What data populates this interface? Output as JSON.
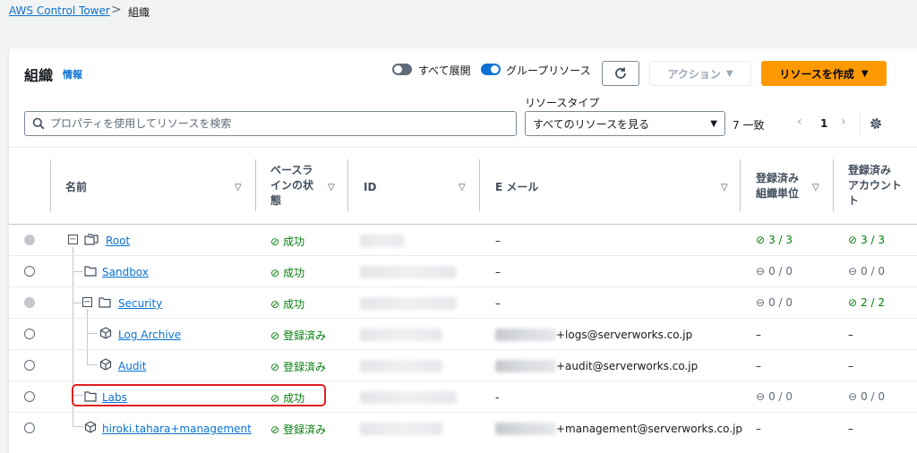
{
  "breadcrumb": {
    "root": "AWS Control Tower",
    "separator": ">",
    "current": "組織"
  },
  "panel": {
    "title": "組織",
    "info": "情報",
    "expand_all_label": "すべて展開",
    "group_resources_label": "グループリソース",
    "action_label": "アクション",
    "create_label": "リソースを作成",
    "search_placeholder": "プロパティを使用してリソースを検索",
    "resource_type_label": "リソースタイプ",
    "resource_type_value": "すべてのリソースを見る",
    "match_count": "7 一致",
    "page": "1"
  },
  "columns": {
    "name": "名前",
    "baseline_1": "ベースラ",
    "baseline_2": "インの状",
    "baseline_3": "態",
    "id": "ID",
    "email": "E メール",
    "ou_1": "登録済み",
    "ou_2": "組織単位",
    "acct_1": "登録済み",
    "acct_2": "アカウント",
    "acct_3": "ト"
  },
  "rows": [
    {
      "name": "Root",
      "status": "成功",
      "email": "–",
      "ou": "3 / 3",
      "acct": "3 / 3"
    },
    {
      "name": "Sandbox",
      "status": "成功",
      "email": "–",
      "ou": "0 / 0",
      "acct": "0 / 0"
    },
    {
      "name": "Security",
      "status": "成功",
      "email": "–",
      "ou": "0 / 0",
      "acct": "2 / 2"
    },
    {
      "name": "Log Archive",
      "status": "登録済み",
      "email": "+logs@serverworks.co.jp",
      "ou": "–",
      "acct": "–"
    },
    {
      "name": "Audit",
      "status": "登録済み",
      "email": "+audit@serverworks.co.jp",
      "ou": "–",
      "acct": "–"
    },
    {
      "name": "Labs",
      "status": "成功",
      "email": "-",
      "ou": "0 / 0",
      "acct": "0 / 0"
    },
    {
      "name": "hiroki.tahara+management",
      "status": "登録済み",
      "email": "+management@serverworks.co.jp",
      "ou": "–",
      "acct": "–"
    }
  ],
  "colors": {
    "accent": "#0972d3",
    "success": "#037f0c",
    "primary_button": "#ff9900",
    "highlight": "#e02020"
  }
}
